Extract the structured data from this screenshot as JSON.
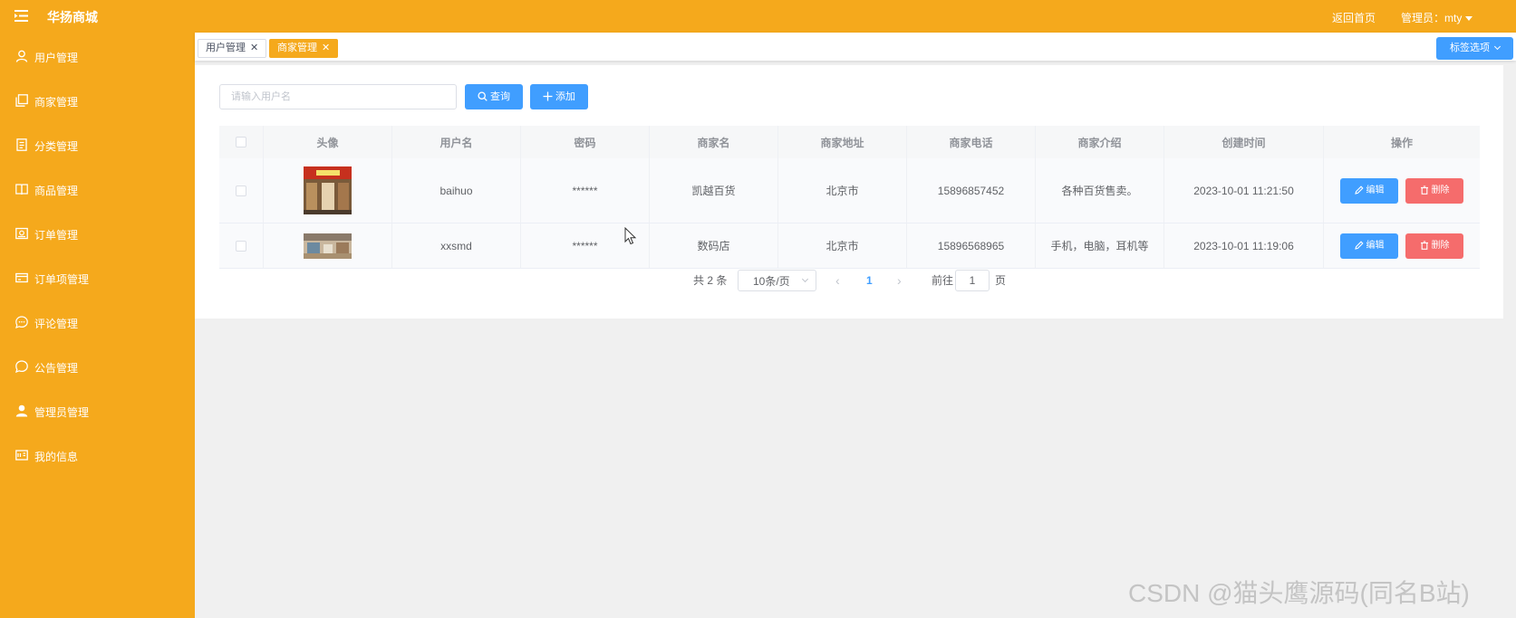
{
  "app": {
    "title": "华扬商城"
  },
  "topbar": {
    "home_link": "返回首页",
    "user_menu": "管理员：mty"
  },
  "sidebar": {
    "items": [
      {
        "label": "用户管理",
        "icon": "user-icon"
      },
      {
        "label": "商家管理",
        "icon": "copy-icon"
      },
      {
        "label": "分类管理",
        "icon": "document-icon"
      },
      {
        "label": "商品管理",
        "icon": "book-icon"
      },
      {
        "label": "订单管理",
        "icon": "picture-icon"
      },
      {
        "label": "订单项管理",
        "icon": "credit-card-icon"
      },
      {
        "label": "评论管理",
        "icon": "chat-dot-icon"
      },
      {
        "label": "公告管理",
        "icon": "chat-round-icon"
      },
      {
        "label": "管理员管理",
        "icon": "user-solid-icon"
      },
      {
        "label": "我的信息",
        "icon": "postcard-icon"
      }
    ]
  },
  "tabs": {
    "items": [
      {
        "label": "用户管理",
        "active": false
      },
      {
        "label": "商家管理",
        "active": true
      }
    ],
    "options_label": "标签选项"
  },
  "toolbar": {
    "search_placeholder": "请输入用户名",
    "search_value": "",
    "query_label": "查询",
    "add_label": "添加"
  },
  "table": {
    "headers": [
      "头像",
      "用户名",
      "密码",
      "商家名",
      "商家地址",
      "商家电话",
      "商家介绍",
      "创建时间",
      "操作"
    ],
    "rows": [
      {
        "avatar": "store-front-photo",
        "username": "baihuo",
        "password": "******",
        "shop_name": "凯越百货",
        "address": "北京市",
        "phone": "15896857452",
        "intro": "各种百货售卖。",
        "created": "2023-10-01 11:21:50"
      },
      {
        "avatar": "digital-store-photo",
        "username": "xxsmd",
        "password": "******",
        "shop_name": "数码店",
        "address": "北京市",
        "phone": "15896568965",
        "intro": "手机，电脑，耳机等",
        "created": "2023-10-01 11:19:06"
      }
    ],
    "edit_label": "编辑",
    "delete_label": "删除"
  },
  "pagination": {
    "total_text": "共 2 条",
    "page_size": "10条/页",
    "current_page": "1",
    "goto_label": "前往",
    "goto_value": "1",
    "page_suffix": "页"
  },
  "watermark": "CSDN @猫头鹰源码(同名B站)",
  "colors": {
    "brand": "#f5a91c",
    "primary": "#409eff",
    "danger": "#f56c6c"
  }
}
